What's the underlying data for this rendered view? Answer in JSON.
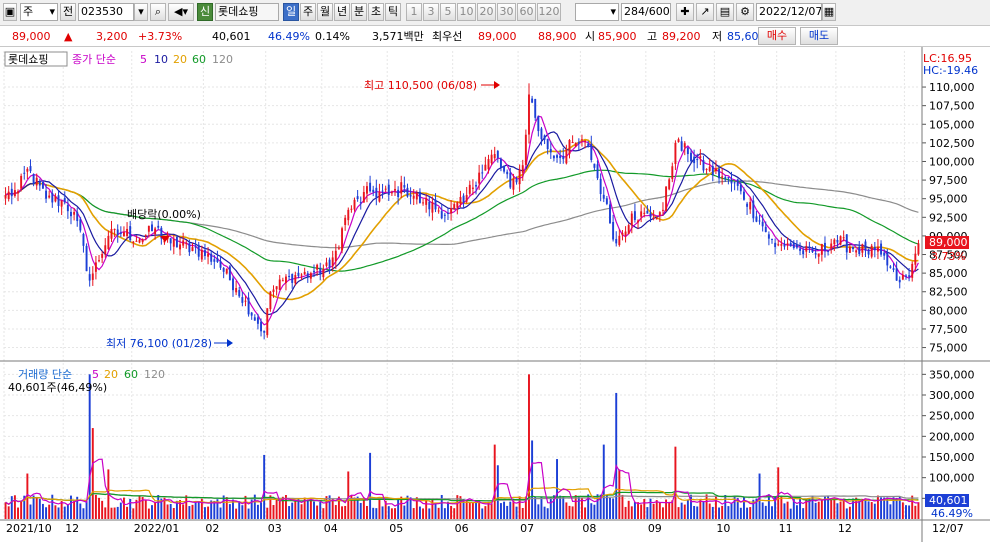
{
  "toolbar": {
    "market_type": "주",
    "prev_label": "전",
    "code": "023530",
    "credit_badge": "신",
    "stock_name": "롯데쇼핑",
    "periods": [
      "일",
      "주",
      "월",
      "년",
      "분",
      "초",
      "틱"
    ],
    "selected_period": "일",
    "intervals": [
      "1",
      "3",
      "5",
      "10",
      "20",
      "30",
      "60",
      "120"
    ],
    "count": "284",
    "count_total": "/600",
    "date": "2022/12/07"
  },
  "quote": {
    "price": "89,000",
    "change": "3,200",
    "change_pct": "+3.73%",
    "volume": "40,601",
    "vol_ratio": "46.49%",
    "turnover": "0.14%",
    "amount": "3,571백만",
    "best_label": "최우선",
    "ask": "89,000",
    "bid": "88,900",
    "open_label": "시",
    "open": "85,900",
    "high_label": "고",
    "high": "89,200",
    "low_label": "저",
    "low": "85,600",
    "buy_label": "매수",
    "sell_label": "매도"
  },
  "colors": {
    "up": "#e8141e",
    "down": "#1c3fd6",
    "ma5": "#c800c8",
    "ma10": "#1a1aa0",
    "ma20": "#e2a000",
    "ma60": "#129a28",
    "ma120": "#8c8c8c"
  },
  "chart_data": [
    {
      "type": "candlestick",
      "legend": {
        "name": "롯데쇼핑",
        "label": "종가 단순",
        "periods": [
          "5",
          "10",
          "20",
          "60",
          "120"
        ]
      },
      "lc_label": "LC:16.95",
      "hc_label": "HC:-19.46",
      "y_ticks": [
        75000,
        77500,
        80000,
        82500,
        85000,
        87500,
        90000,
        92500,
        95000,
        97500,
        100000,
        102500,
        105000,
        107500,
        110000
      ],
      "y_tick_labels": [
        "75,000",
        "77,500",
        "80,000",
        "82,500",
        "85,000",
        "87,500",
        "90,000",
        "92,500",
        "95,000",
        "97,500",
        "100,000",
        "102,500",
        "105,000",
        "107,500",
        "110,000"
      ],
      "ylim": [
        74000,
        113500
      ],
      "last_price_label": "89,000",
      "last_change_label": "3.73%",
      "annotations": {
        "high": "최고 110,500 (06/08)",
        "low": "최저 76,100 (01/28)",
        "dividend": "배당락(0.00%)"
      },
      "anchors": [
        [
          "2021-10-01",
          95500
        ],
        [
          "2021-10-08",
          96000
        ],
        [
          "2021-10-14",
          99000
        ],
        [
          "2021-10-22",
          95000
        ],
        [
          "2021-11-01",
          94500
        ],
        [
          "2021-11-05",
          92000
        ],
        [
          "2021-11-11",
          84000
        ],
        [
          "2021-11-19",
          90000
        ],
        [
          "2021-11-26",
          90500
        ],
        [
          "2021-12-03",
          89500
        ],
        [
          "2021-12-10",
          91000
        ],
        [
          "2021-12-17",
          89000
        ],
        [
          "2021-12-28",
          88500
        ],
        [
          "2022-01-07",
          86500
        ],
        [
          "2022-01-17",
          83000
        ],
        [
          "2022-01-28",
          77000
        ],
        [
          "2022-02-04",
          82500
        ],
        [
          "2022-02-14",
          84500
        ],
        [
          "2022-02-23",
          85000
        ],
        [
          "2022-03-04",
          85800
        ],
        [
          "2022-03-08",
          88000
        ],
        [
          "2022-03-15",
          93500
        ],
        [
          "2022-03-24",
          96000
        ],
        [
          "2022-04-01",
          95500
        ],
        [
          "2022-04-08",
          96500
        ],
        [
          "2022-04-18",
          94500
        ],
        [
          "2022-04-28",
          93000
        ],
        [
          "2022-05-06",
          94500
        ],
        [
          "2022-05-13",
          98500
        ],
        [
          "2022-05-20",
          101000
        ],
        [
          "2022-05-27",
          96500
        ],
        [
          "2022-06-03",
          99500
        ],
        [
          "2022-06-08",
          109000
        ],
        [
          "2022-06-14",
          103000
        ],
        [
          "2022-06-21",
          100500
        ],
        [
          "2022-06-29",
          102500
        ],
        [
          "2022-07-05",
          102000
        ],
        [
          "2022-07-12",
          95000
        ],
        [
          "2022-07-18",
          89000
        ],
        [
          "2022-07-25",
          93000
        ],
        [
          "2022-08-02",
          92500
        ],
        [
          "2022-08-08",
          93500
        ],
        [
          "2022-08-12",
          102500
        ],
        [
          "2022-08-19",
          101000
        ],
        [
          "2022-08-29",
          99000
        ],
        [
          "2022-09-05",
          98000
        ],
        [
          "2022-09-15",
          96000
        ],
        [
          "2022-09-23",
          92000
        ],
        [
          "2022-09-30",
          88500
        ],
        [
          "2022-10-07",
          89000
        ],
        [
          "2022-10-14",
          88000
        ],
        [
          "2022-10-21",
          87500
        ],
        [
          "2022-10-31",
          89500
        ],
        [
          "2022-11-07",
          88500
        ],
        [
          "2022-11-14",
          88000
        ],
        [
          "2022-11-21",
          87500
        ],
        [
          "2022-11-28",
          84000
        ],
        [
          "2022-12-02",
          84500
        ],
        [
          "2022-12-07",
          89000
        ]
      ]
    },
    {
      "type": "bar",
      "legend": {
        "label": "거래량 단순",
        "periods": [
          "5",
          "20",
          "60",
          "120"
        ],
        "current": "40,601주(46,49%)"
      },
      "y_ticks": [
        50000,
        100000,
        150000,
        200000,
        250000,
        300000,
        350000
      ],
      "y_tick_labels": [
        "50,000",
        "100,000",
        "150,000",
        "200,000",
        "250,000",
        "300,000",
        "350,000"
      ],
      "ylim": [
        0,
        375000
      ],
      "last_volume_label": "40,601",
      "last_ratio_label": "46.49%",
      "spikes": [
        [
          "2021-10-14",
          110000
        ],
        [
          "2021-11-11",
          350000
        ],
        [
          "2021-11-12",
          220000
        ],
        [
          "2021-11-19",
          120000
        ],
        [
          "2022-01-28",
          155000
        ],
        [
          "2022-03-15",
          115000
        ],
        [
          "2022-03-24",
          160000
        ],
        [
          "2022-05-20",
          180000
        ],
        [
          "2022-05-23",
          130000
        ],
        [
          "2022-06-08",
          350000
        ],
        [
          "2022-06-09",
          190000
        ],
        [
          "2022-06-21",
          145000
        ],
        [
          "2022-07-12",
          180000
        ],
        [
          "2022-07-18",
          305000
        ],
        [
          "2022-07-19",
          120000
        ],
        [
          "2022-08-12",
          175000
        ],
        [
          "2022-09-23",
          110000
        ],
        [
          "2022-10-04",
          125000
        ]
      ]
    }
  ],
  "x_axis": {
    "labels": [
      "2021/10",
      "12",
      "2022/01",
      "02",
      "03",
      "04",
      "05",
      "06",
      "07",
      "08",
      "09",
      "10",
      "11",
      "12"
    ],
    "right_label": "12/07"
  }
}
